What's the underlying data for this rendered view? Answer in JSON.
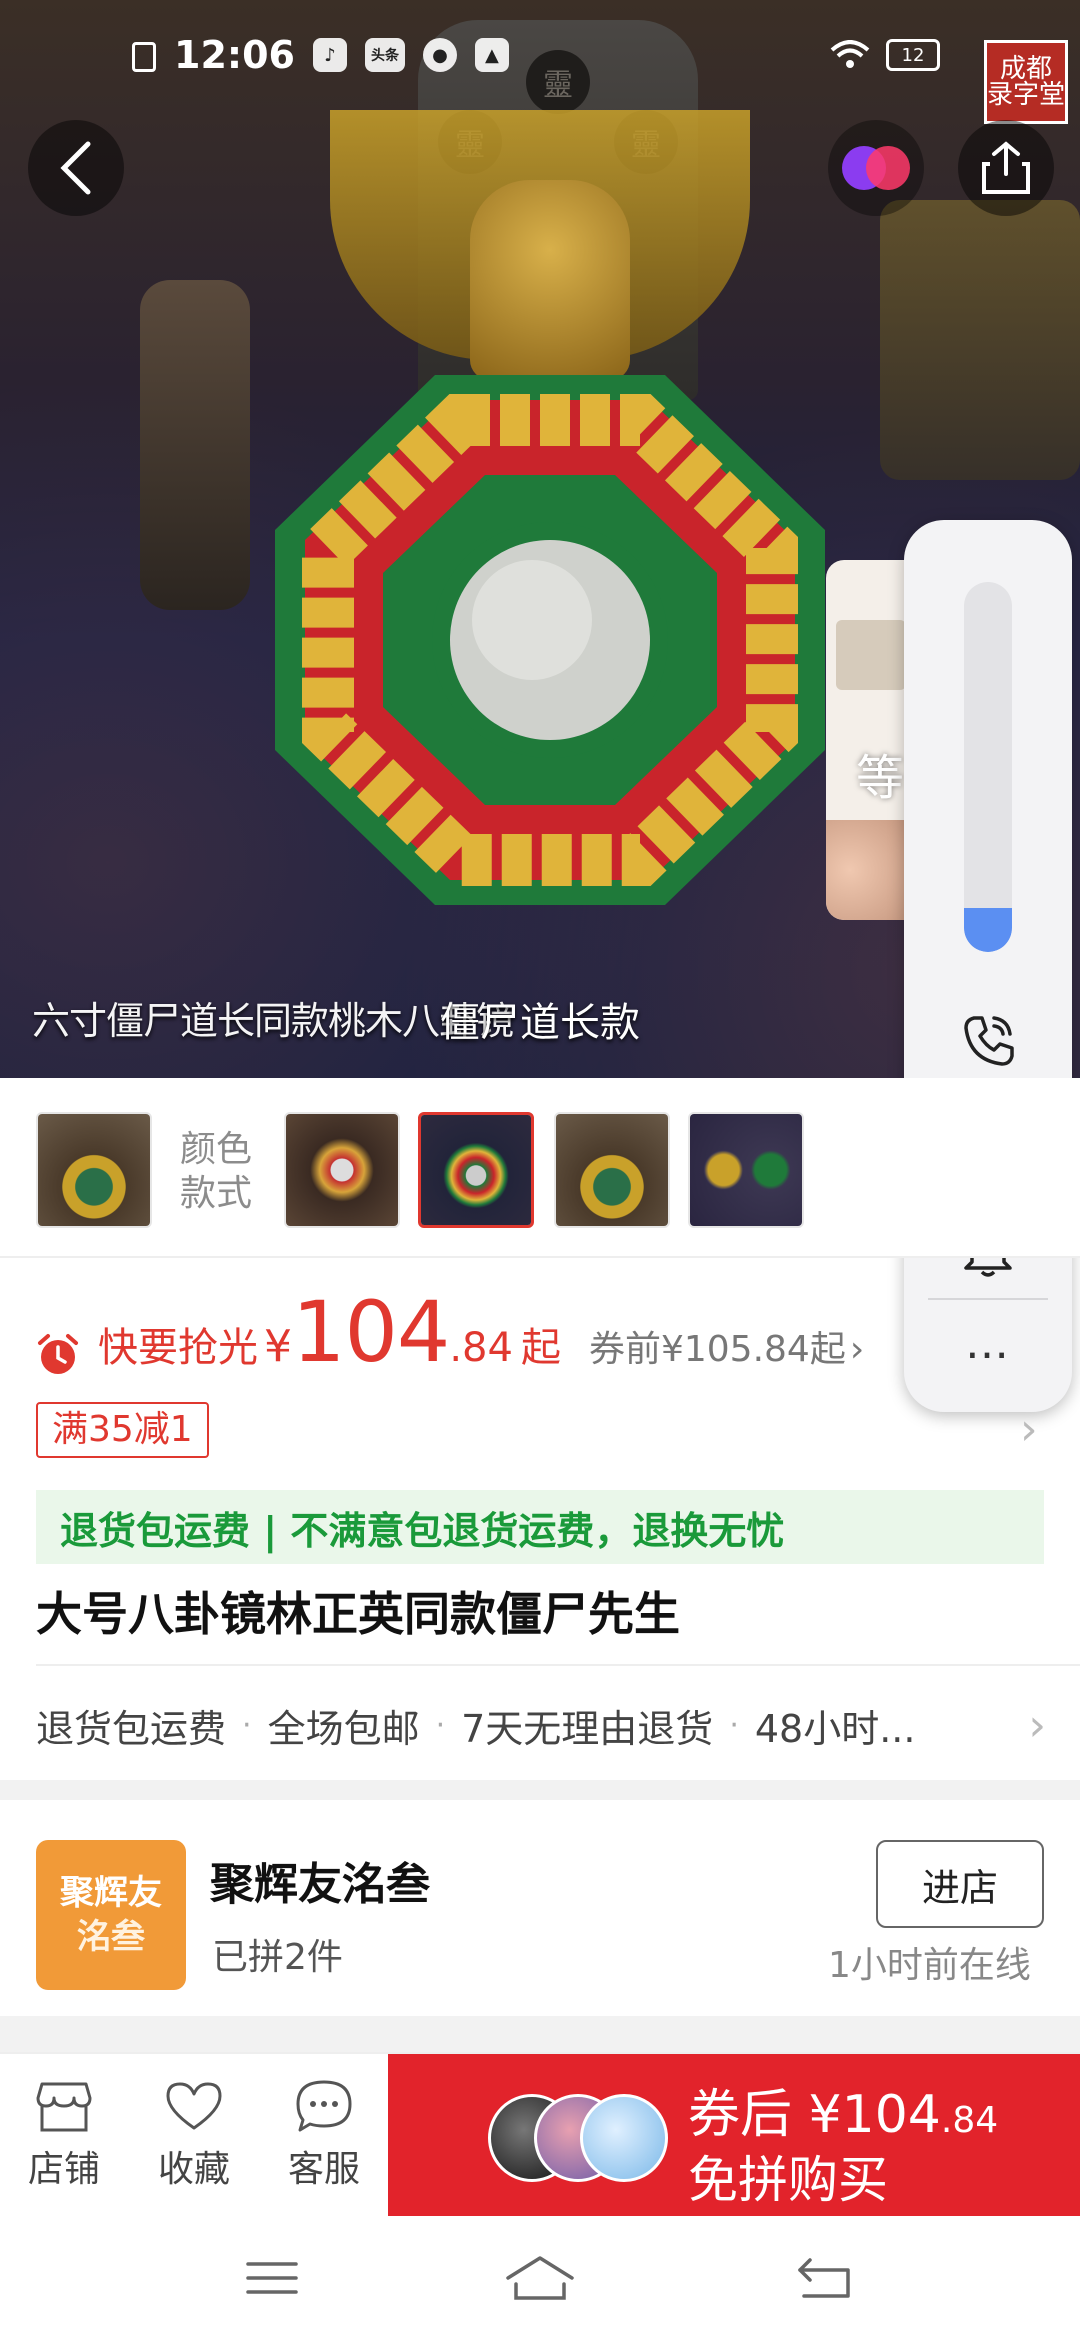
{
  "status_bar": {
    "time": "12:06",
    "notification_icons": [
      "tiktok-icon",
      "toutiao-icon",
      "wechat-icon",
      "gallery-icon"
    ],
    "battery": "12",
    "toutiao_label": "头条"
  },
  "hero": {
    "caption_overlay": "六寸僵尸道长同款桃木八卦镜",
    "variant_caption": "僵尸道长款",
    "stamp_text": "成都 录字堂",
    "tablet_glyphs": [
      "靈",
      "靈",
      "靈"
    ]
  },
  "call_widget": {
    "preview_text": "等 听",
    "volume_level": 0.12,
    "call_label": "通话",
    "more_label": "…"
  },
  "variants": {
    "label": "颜色\n款式",
    "selected_index": 2
  },
  "price": {
    "label": "快要抢光",
    "currency": "¥",
    "integer": "104",
    "decimal": ".84",
    "suffix": "起",
    "before_coupon": "券前¥105.84起",
    "chevron": "›",
    "promo_badge": "满35减1"
  },
  "guarantee": "退货包运费 | 不满意包退货运费，退换无忧",
  "product_title": "大号八卦镜林正英同款僵尸先生",
  "services": [
    "退货包运费",
    "全场包邮",
    "7天无理由退货",
    "48小时..."
  ],
  "services_sep": "·",
  "shop": {
    "logo_line1": "聚辉友",
    "logo_line2": "洺叁",
    "name": "聚辉友洺叁",
    "subtitle": "已拼2件",
    "enter_label": "进店",
    "online_status": "1小时前在线"
  },
  "bottom_bar": {
    "store": "店铺",
    "favorite": "收藏",
    "service": "客服",
    "buy_line1_prefix": "券后",
    "buy_currency": "¥",
    "buy_int": "104",
    "buy_dec": ".84",
    "buy_line2": "免拼购买"
  },
  "colors": {
    "accent_red": "#e0382f",
    "buy_red": "#e2232b",
    "guarantee_green": "#1a9a3a",
    "shop_orange": "#f19a38",
    "volume_blue": "#5b8ff2"
  }
}
